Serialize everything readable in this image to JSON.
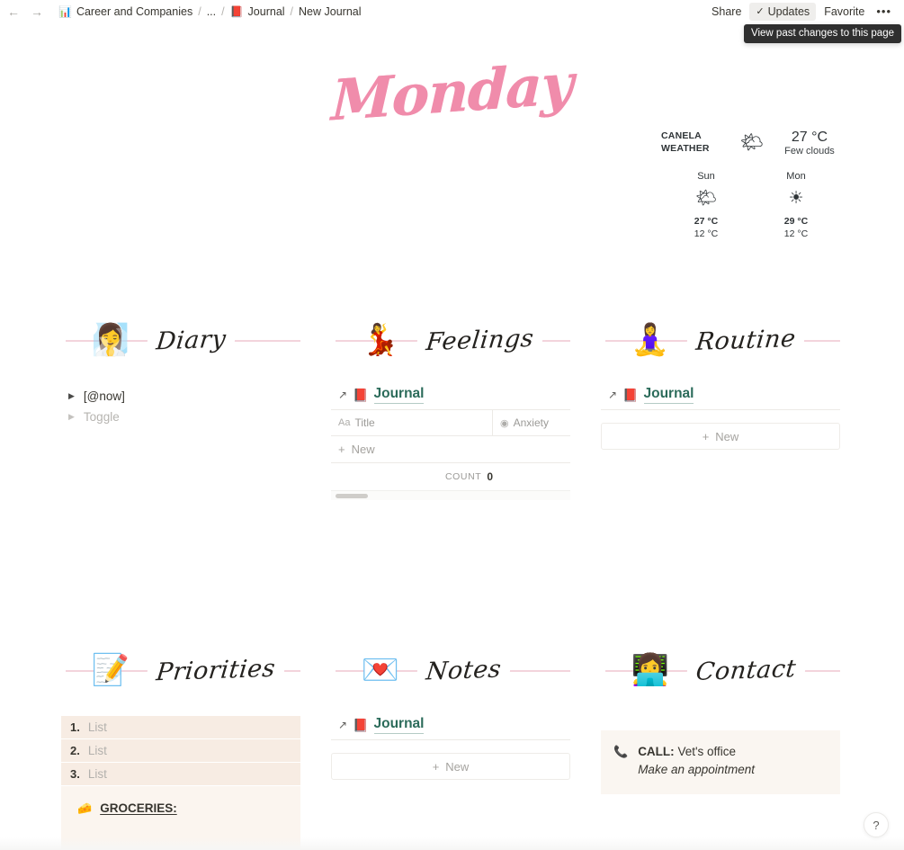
{
  "topbar": {
    "back_icon": "arrow-left-icon",
    "forward_icon": "arrow-right-icon",
    "breadcrumbs": [
      {
        "emoji": "📊",
        "label": "Career and Companies"
      },
      {
        "emoji": "",
        "label": "..."
      },
      {
        "emoji": "📕",
        "label": "Journal"
      },
      {
        "emoji": "",
        "label": "New Journal"
      }
    ],
    "separator": "/",
    "share_label": "Share",
    "updates_label": "Updates",
    "updates_check": "✓",
    "favorite_label": "Favorite",
    "more_label": "•••",
    "tooltip": "View past changes to this page"
  },
  "title": "Monday",
  "title_color": "#f08cab",
  "weather": {
    "city_line1": "CANELA",
    "city_line2": "WEATHER",
    "current_icon": "sun-behind-cloud-icon",
    "current_temp": "27 °C",
    "current_desc": "Few clouds",
    "days": [
      {
        "name": "Sun",
        "icon": "sun-behind-cloud-icon",
        "high": "27 °C",
        "low": "12 °C"
      },
      {
        "name": "Mon",
        "icon": "sun-icon",
        "high": "29 °C",
        "low": "12 °C"
      }
    ]
  },
  "sections": {
    "diary": {
      "heading": "Diary",
      "illustration": "woman-reading-illustration",
      "toggles": [
        {
          "label": "[@now]",
          "muted": false
        },
        {
          "label": "Toggle",
          "muted": true
        }
      ]
    },
    "feelings": {
      "heading": "Feelings",
      "illustration": "couple-dancing-illustration",
      "db": {
        "arrow": "↗",
        "emoji": "📕",
        "title": "Journal",
        "columns": [
          {
            "icon": "title-icon",
            "label": "Title"
          },
          {
            "icon": "select-icon",
            "label": "Anxiety"
          }
        ],
        "new_label": "New",
        "count_label": "COUNT",
        "count_value": "0"
      }
    },
    "routine": {
      "heading": "Routine",
      "illustration": "woman-sitting-chair-illustration",
      "db": {
        "arrow": "↗",
        "emoji": "📕",
        "title": "Journal",
        "new_label": "New"
      }
    },
    "priorities": {
      "heading": "Priorities",
      "illustration": "pink-checklist-notepad-illustration",
      "list": [
        {
          "n": "1.",
          "text": "List"
        },
        {
          "n": "2.",
          "text": "List"
        },
        {
          "n": "3.",
          "text": "List"
        }
      ],
      "groceries": {
        "emoji": "🧀",
        "label": "GROCERIES:"
      }
    },
    "notes": {
      "heading": "Notes",
      "illustration": "folded-letter-illustration",
      "db": {
        "arrow": "↗",
        "emoji": "📕",
        "title": "Journal",
        "new_label": "New"
      }
    },
    "contact": {
      "heading": "Contact",
      "illustration": "person-laptop-illustration",
      "callout": {
        "icon": "phone-icon",
        "strong": "CALL:",
        "text": " Vet's office",
        "italic": "Make an appointment"
      }
    }
  },
  "help": {
    "label": "?"
  }
}
